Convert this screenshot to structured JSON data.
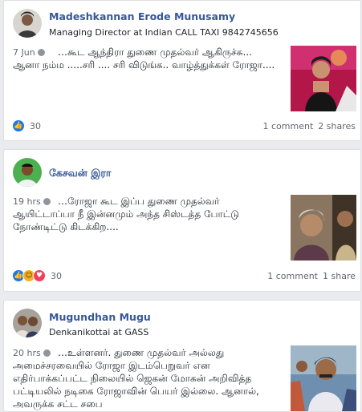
{
  "posts": [
    {
      "author": "Madeshkannan Erode Munusamy",
      "subtitle": "Managing Director at Indian CALL TAXI 9842745656",
      "time": "7 Jun",
      "text": "…கூட ஆந்திரா துணை முதல்வர் ஆகிருச்சு... ஆனா நம்ம .....சரி .... சரி விடுங்க.. வாழ்த்துக்கள் ரோஜா....",
      "reaction_count": "30",
      "comments": "1 comment",
      "shares": "2 shares"
    },
    {
      "author": "கேசவன் இரா",
      "subtitle": "",
      "time": "19 hrs",
      "text": "…ரோஜா கூட இப்ப துணை முதல்வர் ஆயிட்டாப்பா நீ இன்னமும் அந்த சிஸ்டத்த போட்டு நோண்டிட்டு கிடக்கிற....",
      "reaction_count": "30",
      "comments": "1 comment",
      "shares": "1 share"
    },
    {
      "author": "Mugundhan Mugu",
      "subtitle": "Denkanikottai at GASS",
      "time": "20 hrs",
      "text": "…உள்ளனர். துணை முதல்வர் அல்லது அமைச்சரவையில் ரோஜா இடம்பெறுவர் என எதிர்பாக்கப்பட்ட நிலையில் ஜெகன் மோகன் அறிவித்த பட்டியலில் நடிகை ரோஜாவின் பெயர் இல்லை. ஆனால், அவருக்க சட்ட சபை"
    }
  ],
  "colors": {
    "link": "#365899",
    "background": "#e9ebee",
    "like": "#1877f2",
    "love": "#f33e58",
    "haha": "#f7b125"
  }
}
